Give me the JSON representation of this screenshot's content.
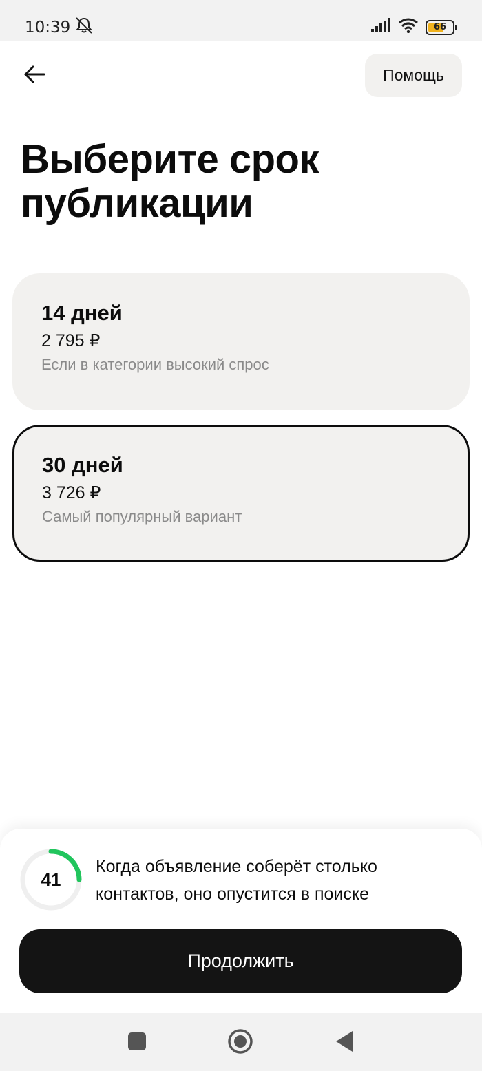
{
  "status_bar": {
    "time": "10:39",
    "battery_level": "66",
    "icons": [
      "mute-icon",
      "signal-icon",
      "wifi-icon",
      "battery-icon"
    ]
  },
  "header": {
    "back_icon": "arrow-left-icon",
    "help_label": "Помощь"
  },
  "title": "Выберите срок публикации",
  "options": [
    {
      "days": "14 дней",
      "price": "2 795 ₽",
      "note": "Если в категории высокий спрос",
      "selected": false
    },
    {
      "days": "30 дней",
      "price": "3 726 ₽",
      "note": "Самый популярный вариант",
      "selected": true
    }
  ],
  "bottom_sheet": {
    "contacts_count": "41",
    "contacts_progress": 0.25,
    "contacts_text": "Когда объявление соберёт столько контактов, оно опустится в поиске",
    "continue_label": "Продолжить"
  },
  "colors": {
    "accent_progress": "#21c55d",
    "selected_border": "#0c0c0c",
    "card_bg": "#f2f1ef",
    "primary_button": "#141414"
  },
  "nav_bar": {
    "icons": [
      "square-icon",
      "circle-home-icon",
      "triangle-back-icon"
    ]
  }
}
